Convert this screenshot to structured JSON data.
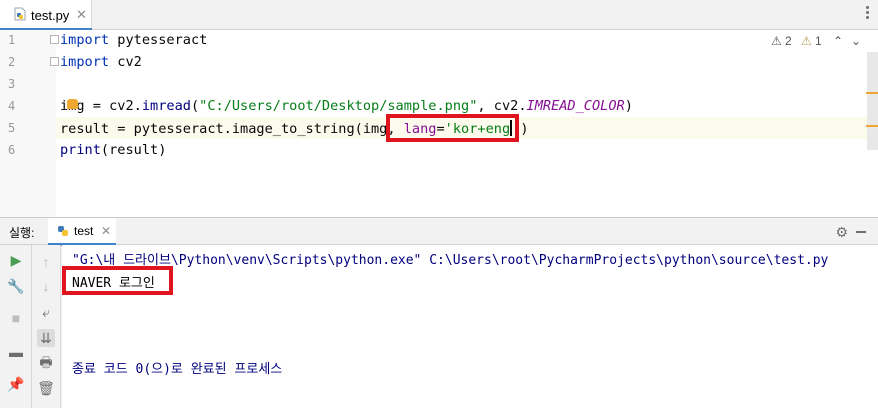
{
  "editor_tab": {
    "filename": "test.py"
  },
  "code": {
    "line_numbers": [
      "1",
      "2",
      "3",
      "4",
      "5",
      "6"
    ],
    "line1": {
      "kw": "import",
      "rest": " pytesseract"
    },
    "line2": {
      "kw": "import",
      "rest": " cv2"
    },
    "line4": {
      "a": "img = cv2.",
      "fn": "imread",
      "b": "(",
      "str": "\"C:/Users/root/Desktop/sample.png\"",
      "c": ", cv2.",
      "const": "IMREAD_COLOR",
      "d": ")"
    },
    "line5": {
      "a": "result = pytesseract.image_to_string(img, ",
      "param": "lang",
      "eq": "=",
      "str1": "'kor+eng",
      "str2": "'",
      "end": ")"
    },
    "line6": {
      "fn": "print",
      "rest": "(result)"
    }
  },
  "inspections": {
    "warnings": "2",
    "weak_warnings": "1"
  },
  "run_panel": {
    "label": "실행:",
    "tab": "test",
    "command": "\"G:\\내 드라이브\\Python\\venv\\Scripts\\python.exe\" C:\\Users\\root\\PycharmProjects\\python\\source\\test.py",
    "output": "NAVER 로그인",
    "exit_message": "종료 코드 0(으)로 완료된 프로세스"
  },
  "colors": {
    "highlight_box": "#e0141e",
    "keyword": "#0033b3",
    "string": "#067d17",
    "tab_accent": "#4083c9"
  }
}
